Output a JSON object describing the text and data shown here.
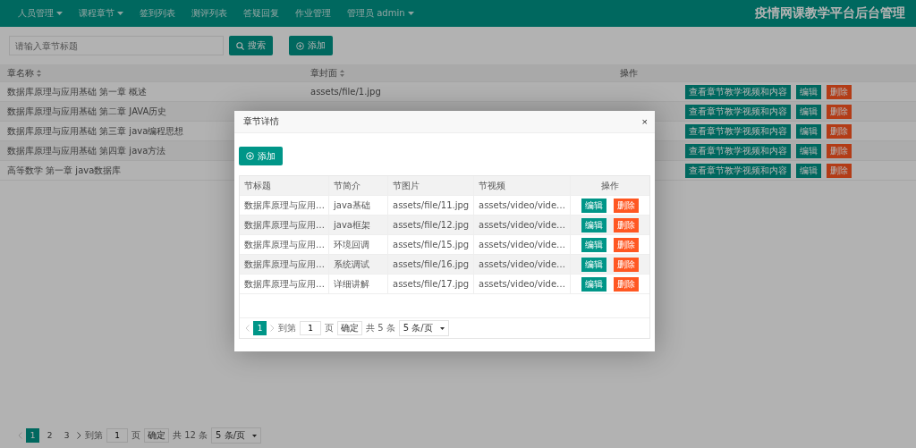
{
  "nav": {
    "items": [
      {
        "label": "人员管理",
        "dropdown": true
      },
      {
        "label": "课程章节",
        "dropdown": true
      },
      {
        "label": "签到列表",
        "dropdown": false
      },
      {
        "label": "测评列表",
        "dropdown": false
      },
      {
        "label": "答疑回复",
        "dropdown": false
      },
      {
        "label": "作业管理",
        "dropdown": false
      },
      {
        "label": "管理员 admin",
        "dropdown": true
      }
    ],
    "title": "疫情网课教学平台后台管理"
  },
  "search": {
    "placeholder": "请输入章节标题",
    "search_button": "搜索",
    "add_button": "添加"
  },
  "table": {
    "columns": [
      "章名称",
      "章封面",
      "操作"
    ],
    "rows": [
      {
        "name": "数据库原理与应用基础 第一章 概述",
        "cover": "assets/file/1.jpg",
        "actions": [
          "查看章节教学视频和内容",
          "编辑",
          "删除"
        ]
      },
      {
        "name": "数据库原理与应用基础 第二章 JAVA历史",
        "actions": [
          "查看章节教学视频和内容",
          "编辑",
          "删除"
        ]
      },
      {
        "name": "数据库原理与应用基础 第三章 java编程思想",
        "actions": [
          "查看章节教学视频和内容",
          "编辑",
          "删除"
        ]
      },
      {
        "name": "数据库原理与应用基础 第四章 java方法",
        "actions": [
          "查看章节教学视频和内容",
          "编辑",
          "删除"
        ]
      },
      {
        "name": "高等数学 第一章 java数据库",
        "actions": [
          "查看章节教学视频和内容",
          "编辑",
          "删除"
        ]
      }
    ]
  },
  "pagination": {
    "pages": [
      {
        "label": "1",
        "selected": true
      },
      {
        "label": "2",
        "selected": false
      },
      {
        "label": "3",
        "selected": false
      }
    ],
    "goto_label": "到第",
    "goto_value": "1",
    "page_unit": "页",
    "confirm": "确定",
    "total": "共 12 条",
    "page_size": "5 条/页"
  },
  "dialog": {
    "title": "章节详情",
    "close": "×",
    "add_button": "添加",
    "columns": [
      "节标题",
      "节简介",
      "节图片",
      "节视频",
      "操作"
    ],
    "rows": [
      {
        "title": "数据库原理与应用…",
        "intro": "java基础",
        "image": "assets/file/11.jpg",
        "video": "assets/video/vide…",
        "actions": [
          "编辑",
          "删除"
        ]
      },
      {
        "title": "数据库原理与应用…",
        "intro": "java框架",
        "image": "assets/file/12.jpg",
        "video": "assets/video/vide…",
        "actions": [
          "编辑",
          "删除"
        ]
      },
      {
        "title": "数据库原理与应用…",
        "intro": "环境回调",
        "image": "assets/file/15.jpg",
        "video": "assets/video/vide…",
        "actions": [
          "编辑",
          "删除"
        ]
      },
      {
        "title": "数据库原理与应用…",
        "intro": "系统调试",
        "image": "assets/file/16.jpg",
        "video": "assets/video/vide…",
        "actions": [
          "编辑",
          "删除"
        ]
      },
      {
        "title": "数据库原理与应用…",
        "intro": "详细讲解",
        "image": "assets/file/17.jpg",
        "video": "assets/video/vide…",
        "actions": [
          "编辑",
          "删除"
        ]
      }
    ],
    "pagination": {
      "pages": [
        {
          "label": "1",
          "selected": true
        }
      ],
      "goto_label": "到第",
      "goto_value": "1",
      "page_unit": "页",
      "confirm": "确定",
      "total": "共 5 条",
      "page_size": "5 条/页"
    }
  }
}
